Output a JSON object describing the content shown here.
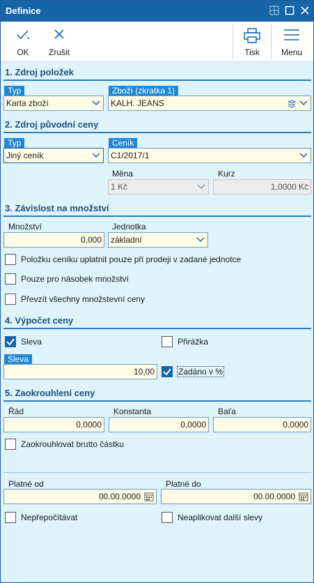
{
  "window": {
    "title": "Definice"
  },
  "toolbar": {
    "ok": "OK",
    "cancel": "Zrušit",
    "print": "Tisk",
    "menu": "Menu"
  },
  "s1": {
    "title": "1. Zdroj položek",
    "typ_label": "Typ",
    "typ_value": "Karta zboží",
    "zbozi_label": "Zboží (zkratka 1)",
    "zbozi_value": "KALH. JEANS"
  },
  "s2": {
    "title": "2. Zdroj původní ceny",
    "typ_label": "Typ",
    "typ_value": "Jiný ceník",
    "cenik_label": "Ceník",
    "cenik_value": "C1/2017/1",
    "mena_label": "Měna",
    "mena_value": "1 Kč",
    "kurz_label": "Kurz",
    "kurz_value": "1,0000 Kč"
  },
  "s3": {
    "title": "3. Závislost na množství",
    "mnozstvi_label": "Množství",
    "mnozstvi_value": "0,000",
    "jednotka_label": "Jednotka",
    "jednotka_value": "základní",
    "cb1": "Položku ceníku uplatnit pouze při prodeji v zadané jednotce",
    "cb2": "Pouze pro násobek množství",
    "cb3": "Převzít všechny množstevní ceny"
  },
  "s4": {
    "title": "4. Výpočet ceny",
    "sleva_cb": "Sleva",
    "prirazka_cb": "Přirážka",
    "sleva_label": "Sleva",
    "sleva_value": "10,00",
    "zadano_cb": "Zadáno v %",
    "sleva_checked": true,
    "prirazka_checked": false,
    "zadano_checked": true
  },
  "s5": {
    "title": "5. Zaokrouhlení ceny",
    "rad_label": "Řád",
    "rad_value": "0,0000",
    "konstanta_label": "Konstanta",
    "konstanta_value": "0,0000",
    "bata_label": "Baťa",
    "bata_value": "0,0000",
    "brutto_cb": "Zaokrouhlovat brutto částku"
  },
  "validity": {
    "od_label": "Platné od",
    "od_value": "00.00.0000",
    "do_label": "Platné do",
    "do_value": "00.00.0000",
    "neprepocitavat": "Nepřepočítávat",
    "neaplikovat": "Neaplikovat další slevy"
  },
  "colors": {
    "accent": "#1565a8",
    "tag": "#1e88d6",
    "panel": "#dff3fb",
    "input": "#fffde6"
  }
}
